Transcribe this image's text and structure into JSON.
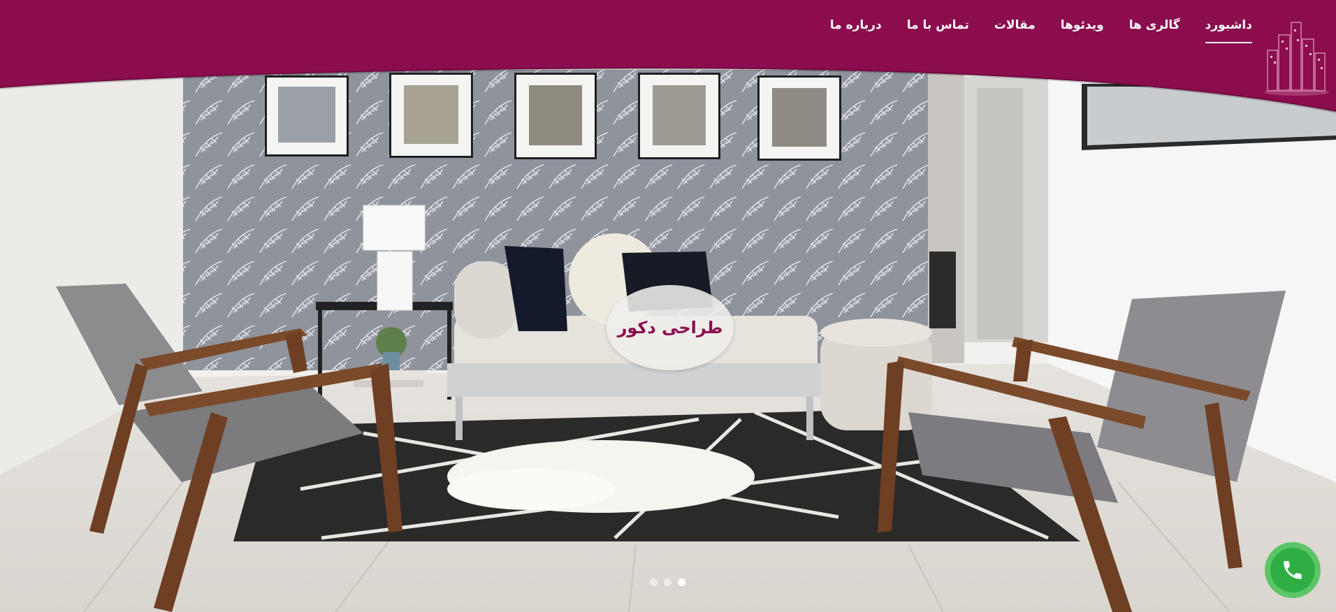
{
  "brand": {
    "primary_color": "#8b0d4e",
    "accent_color": "#2fae43"
  },
  "nav": {
    "items": [
      {
        "label": "داشبورد",
        "active": true
      },
      {
        "label": "گالری ها",
        "active": false
      },
      {
        "label": "ویدئوها",
        "active": false
      },
      {
        "label": "مقالات",
        "active": false
      },
      {
        "label": "تماس با ما",
        "active": false
      },
      {
        "label": "درباره ما",
        "active": false
      }
    ],
    "logo_icon": "city-skyline-icon"
  },
  "hero": {
    "caption": "طراحی دکور",
    "scene": "living-room-photo",
    "slides_count": 3,
    "active_slide": 3
  },
  "call_button": {
    "icon": "phone-icon"
  }
}
